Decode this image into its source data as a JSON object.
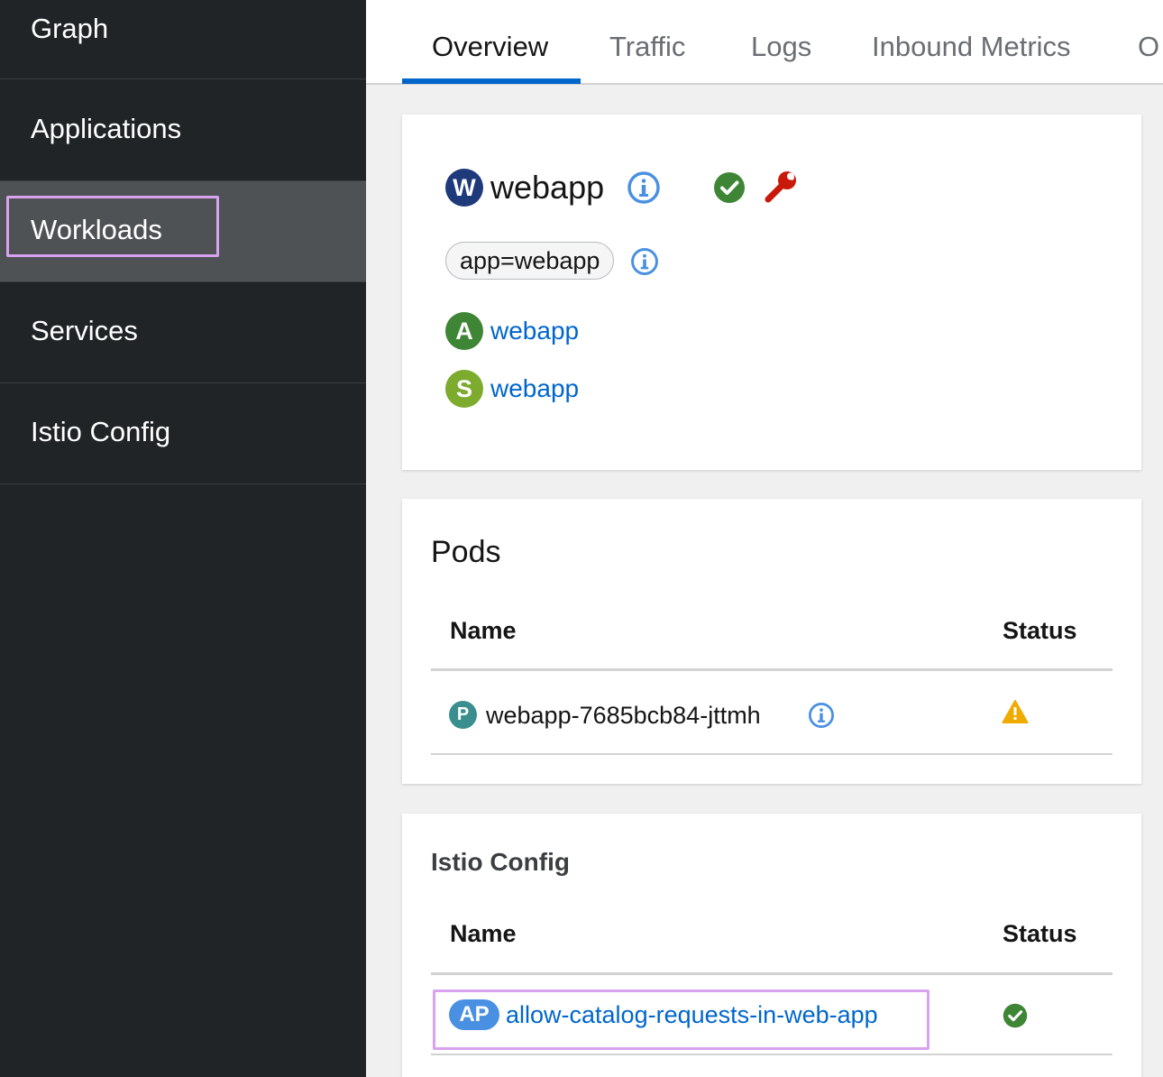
{
  "sidebar": {
    "items": [
      {
        "label": "Graph"
      },
      {
        "label": "Applications"
      },
      {
        "label": "Workloads"
      },
      {
        "label": "Services"
      },
      {
        "label": "Istio Config"
      }
    ]
  },
  "tabs": [
    "Overview",
    "Traffic",
    "Logs",
    "Inbound Metrics",
    "O"
  ],
  "overview": {
    "workload_badge": "W",
    "workload_name": "webapp",
    "label_chip": "app=webapp",
    "app_badge": "A",
    "app_link": "webapp",
    "service_badge": "S",
    "service_link": "webapp"
  },
  "pods": {
    "title": "Pods",
    "col_name": "Name",
    "col_status": "Status",
    "rows": [
      {
        "badge": "P",
        "name": "webapp-7685bcb84-jttmh",
        "status": "warning"
      }
    ]
  },
  "istio_config": {
    "title": "Istio Config",
    "col_name": "Name",
    "col_status": "Status",
    "rows": [
      {
        "badge": "AP",
        "name": "allow-catalog-requests-in-web-app",
        "status": "ok"
      }
    ]
  },
  "colors": {
    "sidebar_bg": "#212427",
    "sidebar_active": "#4f5255",
    "accent": "#0066cc",
    "highlight": "#d8a2f0",
    "success": "#3e8635",
    "warning": "#f0ab00",
    "danger": "#c9190b"
  }
}
